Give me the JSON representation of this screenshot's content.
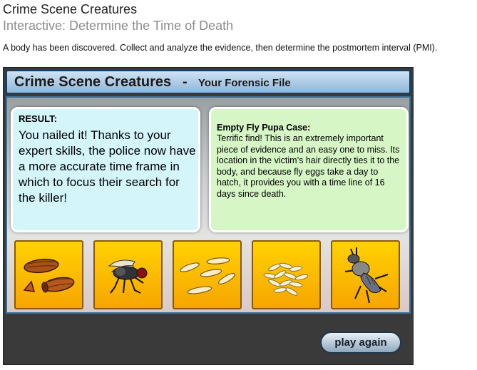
{
  "page": {
    "title": "Crime Scene Creatures",
    "subtitle": "Interactive: Determine the Time of Death",
    "intro": "A body has been discovered. Collect and analyze the evidence, then determine the postmortem interval (PMI)."
  },
  "game": {
    "header_title": "Crime Scene Creatures",
    "header_separator": "-",
    "header_subtitle": "Your Forensic File",
    "result_label": "RESULT:",
    "result_text": "You nailed it! Thanks to your expert skills, the police now have a more accurate time frame in which to focus their search for the killer!",
    "info_title": "Empty Fly Pupa Case:",
    "info_text": "Terrific find! This is an extremely important piece of evidence and an easy one to miss. Its location in the victim’s hair directly ties it to the body, and because fly eggs take a day to hatch, it provides you with a time line of 16 days since death.",
    "evidence_items": [
      {
        "icon": "empty-pupa-case-icon"
      },
      {
        "icon": "adult-fly-icon"
      },
      {
        "icon": "larvae-icon"
      },
      {
        "icon": "fly-eggs-icon"
      },
      {
        "icon": "beetle-icon"
      }
    ],
    "play_again_label": "play again"
  },
  "colors": {
    "header_border": "#0f3f6b",
    "result_bg": "#d4f6fa",
    "info_bg": "#d6f6c6",
    "card_gold": "#ffd200",
    "card_border": "#8a5a00"
  }
}
